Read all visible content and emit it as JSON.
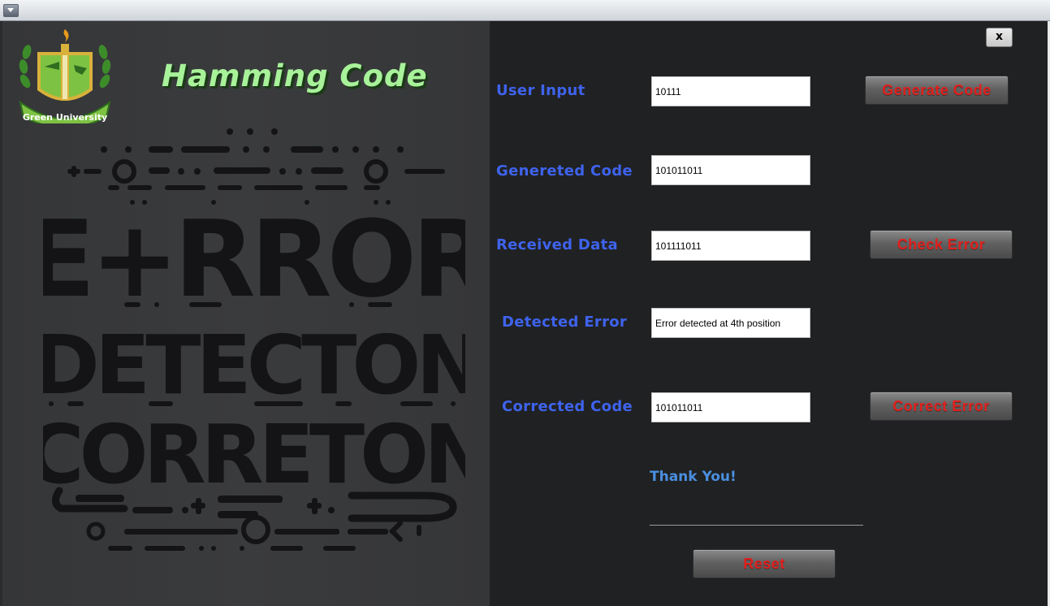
{
  "window": {
    "menu_icon": "dropdown-arrow-icon"
  },
  "branding": {
    "logo_text": "Green University",
    "app_title": "Hamming Code"
  },
  "artwork": {
    "line1": "E+RROR",
    "line2": "DETECTON",
    "line3": "CORRETON"
  },
  "form": {
    "user_input": {
      "label": "User Input",
      "value": "10111"
    },
    "generated_code": {
      "label": "Genereted Code",
      "value": "101011011"
    },
    "received_data": {
      "label": "Received Data",
      "value": "101111011"
    },
    "detected_error": {
      "label": "Detected Error",
      "value": "Error detected at 4th position"
    },
    "corrected_code": {
      "label": "Corrected Code",
      "value": "101011011"
    }
  },
  "buttons": {
    "close": "x",
    "generate": "Generate Code",
    "check": "Check Error",
    "correct": "Correct Error",
    "reset": "Reset"
  },
  "footer": {
    "thanks": "Thank You!"
  },
  "colors": {
    "label": "#3e63ec",
    "button_text": "#e0201d",
    "title": "#a8f29a",
    "panel": "#202123"
  }
}
